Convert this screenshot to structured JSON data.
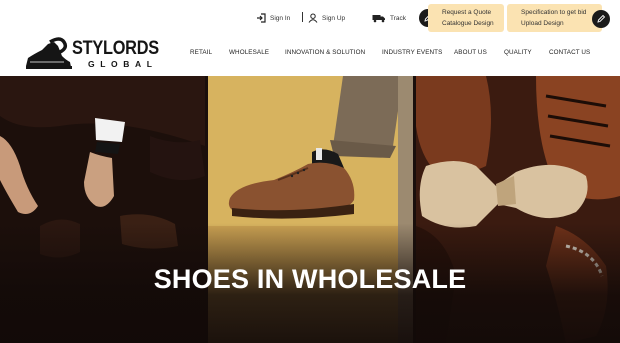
{
  "brand": {
    "name": "STYLORDS",
    "sub": "GLOBAL"
  },
  "topbar": {
    "sign_in": "Sign In",
    "sign_up": "Sign Up",
    "track": "Track"
  },
  "cta": [
    {
      "title": "Request a Quote",
      "subtitle": "Catalogue Design"
    },
    {
      "title": "Specification to get bid",
      "subtitle": "Upload Design"
    }
  ],
  "nav": [
    "RETAIL",
    "WHOLESALE",
    "INNOVATION & SOLUTION",
    "INDUSTRY EVENTS",
    "ABOUT US",
    "QUALITY",
    "CONTACT US"
  ],
  "hero": {
    "title": "SHOES IN WHOLESALE"
  },
  "colors": {
    "cta_bg": "#fbe3b2",
    "hero_dark": "#1a0f0c",
    "panel_yellow": "#d7b35f"
  },
  "icons": [
    "sign-in-icon",
    "user-icon",
    "truck-icon",
    "pen-icon",
    "upload-icon",
    "shoe-logo-icon"
  ]
}
